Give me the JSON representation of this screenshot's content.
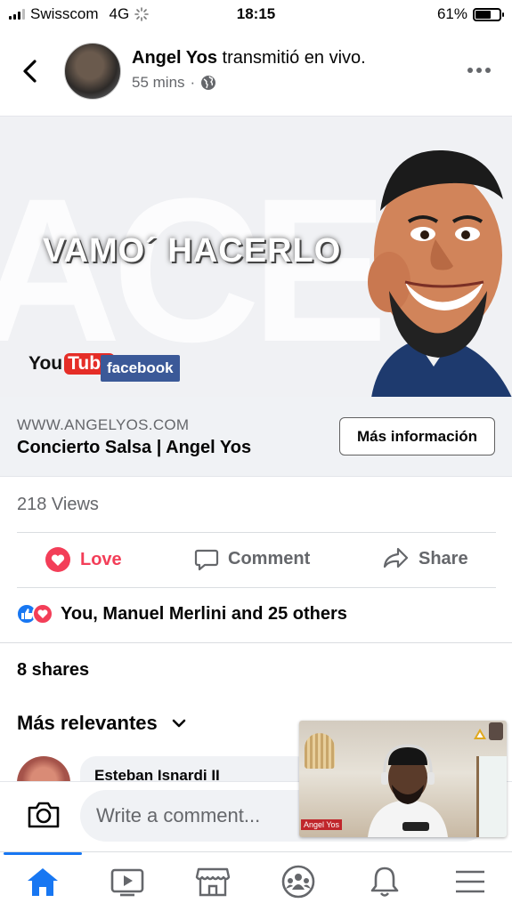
{
  "status_bar": {
    "carrier": "Swisscom",
    "network": "4G",
    "time": "18:15",
    "battery_percent": "61%",
    "battery_level": 0.61
  },
  "post_header": {
    "author": "Angel Yos",
    "action": "transmitió en vivo.",
    "time_ago": "55 mins",
    "privacy_icon": "globe-icon"
  },
  "banner": {
    "background_letters": "ACE",
    "slogan": "VAMO´ HACERLO",
    "youtube_you": "You",
    "youtube_tube": "Tube",
    "facebook_badge": "facebook"
  },
  "link_preview": {
    "url": "WWW.ANGELYOS.COM",
    "title": "Concierto Salsa | Angel Yos",
    "button": "Más información"
  },
  "views": "218 Views",
  "actions": {
    "love": "Love",
    "comment": "Comment",
    "share": "Share"
  },
  "reactions": {
    "summary": "You, Manuel Merlini and 25 others",
    "types": [
      "like",
      "love"
    ]
  },
  "shares": "8 shares",
  "comments": {
    "sort_label": "Más relevantes",
    "first_commenter": "Esteban Isnardi II"
  },
  "comment_input": {
    "placeholder": "Write a comment..."
  },
  "video_pip": {
    "name_tag": "Angel Yos"
  },
  "nav": {
    "items": [
      "home-icon",
      "watch-icon",
      "marketplace-icon",
      "groups-icon",
      "notifications-icon",
      "menu-icon"
    ],
    "active": "home-icon"
  },
  "colors": {
    "facebook_blue": "#1877f2",
    "love_red": "#f33e58",
    "secondary_text": "#65676b"
  }
}
